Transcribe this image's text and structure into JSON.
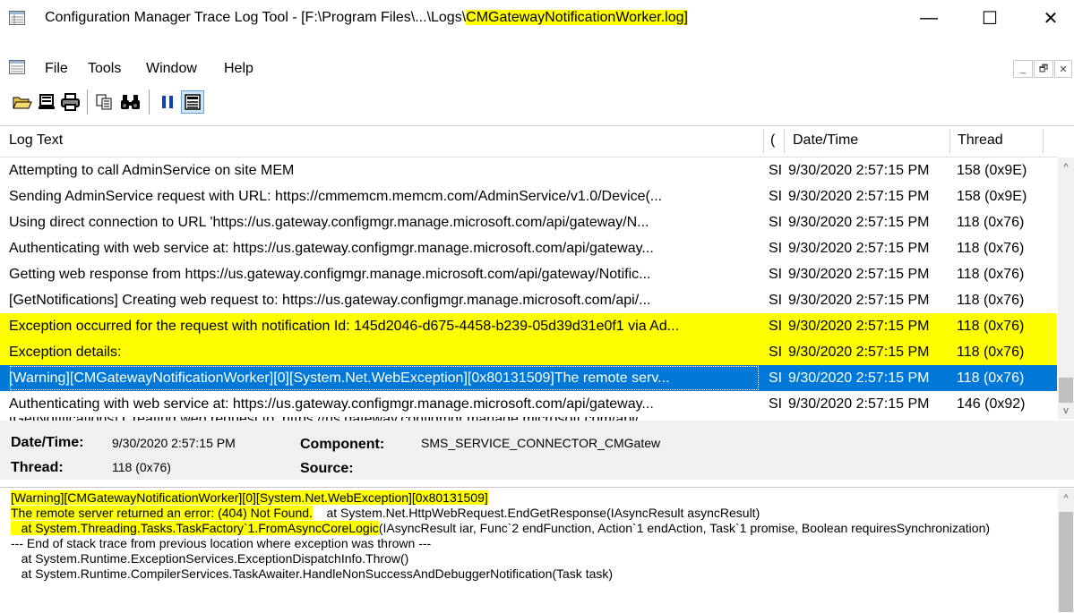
{
  "window": {
    "title_prefix": "Configuration Manager Trace Log Tool - [F:\\Program Files\\...\\Logs\\",
    "title_highlight": "CMGatewayNotificationWorker.log]",
    "minimize": "—",
    "maximize": "☐",
    "close": "✕"
  },
  "menu": {
    "items": [
      "File",
      "Tools",
      "Window",
      "Help"
    ],
    "mdi_minimize": "_",
    "mdi_restore": "🗗",
    "mdi_close": "✕"
  },
  "toolbar": {
    "icons": [
      "open-folder-icon",
      "print-preview-icon",
      "print-icon",
      "copy-icon",
      "find-icon",
      "pause-icon",
      "log-view-icon"
    ]
  },
  "log_list": {
    "columns": {
      "text": "Log Text",
      "component": "(",
      "time": "Date/Time",
      "thread": "Thread"
    },
    "rows": [
      {
        "text": "Attempting to call AdminService on site MEM",
        "component": "SI",
        "time": "9/30/2020 2:57:15 PM",
        "thread": "158 (0x9E)",
        "style": "normal"
      },
      {
        "text": "Sending AdminService request with URL: https://cmmemcm.memcm.com/AdminService/v1.0/Device(...",
        "component": "SI",
        "time": "9/30/2020 2:57:15 PM",
        "thread": "158 (0x9E)",
        "style": "normal"
      },
      {
        "text": "Using direct connection to URL 'https://us.gateway.configmgr.manage.microsoft.com/api/gateway/N...",
        "component": "SI",
        "time": "9/30/2020 2:57:15 PM",
        "thread": "118 (0x76)",
        "style": "normal"
      },
      {
        "text": "Authenticating with web service at: https://us.gateway.configmgr.manage.microsoft.com/api/gateway...",
        "component": "SI",
        "time": "9/30/2020 2:57:15 PM",
        "thread": "118 (0x76)",
        "style": "normal"
      },
      {
        "text": "Getting web response from https://us.gateway.configmgr.manage.microsoft.com/api/gateway/Notific...",
        "component": "SI",
        "time": "9/30/2020 2:57:15 PM",
        "thread": "118 (0x76)",
        "style": "normal"
      },
      {
        "text": "[GetNotifications] Creating web request to: https://us.gateway.configmgr.manage.microsoft.com/api/...",
        "component": "SI",
        "time": "9/30/2020 2:57:15 PM",
        "thread": "118 (0x76)",
        "style": "normal"
      },
      {
        "text": "Exception occurred for the request with notification Id: 145d2046-d675-4458-b239-05d39d31e0f1 via Ad...",
        "component": "SI",
        "time": "9/30/2020 2:57:15 PM",
        "thread": "118 (0x76)",
        "style": "yellow"
      },
      {
        "text": "Exception details:",
        "component": "SI",
        "time": "9/30/2020 2:57:15 PM",
        "thread": "118 (0x76)",
        "style": "yellow"
      },
      {
        "text": "[Warning][CMGatewayNotificationWorker][0][System.Net.WebException][0x80131509]The remote serv...",
        "component": "SI",
        "time": "9/30/2020 2:57:15 PM",
        "thread": "118 (0x76)",
        "style": "sel"
      },
      {
        "text": "Authenticating with web service at: https://us.gateway.configmgr.manage.microsoft.com/api/gateway...",
        "component": "SI",
        "time": "9/30/2020 2:57:15 PM",
        "thread": "146 (0x92)",
        "style": "normal"
      }
    ]
  },
  "details": {
    "datetime_label": "Date/Time:",
    "datetime_value": "9/30/2020 2:57:15 PM",
    "component_label": "Component:",
    "component_value": "SMS_SERVICE_CONNECTOR_CMGatew",
    "thread_label": "Thread:",
    "thread_value": "118 (0x76)",
    "source_label": "Source:",
    "source_value": ""
  },
  "message": {
    "line1_highlight": "[Warning][CMGatewayNotificationWorker][0][System.Net.WebException][0x80131509]",
    "line2_highlight": "The remote server returned an error: (404) Not Found.",
    "line2_rest": "    at System.Net.HttpWebRequest.EndGetResponse(IAsyncResult asyncResult)",
    "line3_highlight": "   at System.Threading.Tasks.TaskFactory`1.FromAsyncCoreLogic",
    "line3_rest": "(IAsyncResult iar, Func`2 endFunction, Action`1 endAction, Task`1 promise, Boolean requiresSynchronization)",
    "line4": "--- End of stack trace from previous location where exception was thrown ---",
    "line5": "   at System.Runtime.ExceptionServices.ExceptionDispatchInfo.Throw()",
    "line6": "   at System.Runtime.CompilerServices.TaskAwaiter.HandleNonSuccessAndDebuggerNotification(Task task)"
  }
}
